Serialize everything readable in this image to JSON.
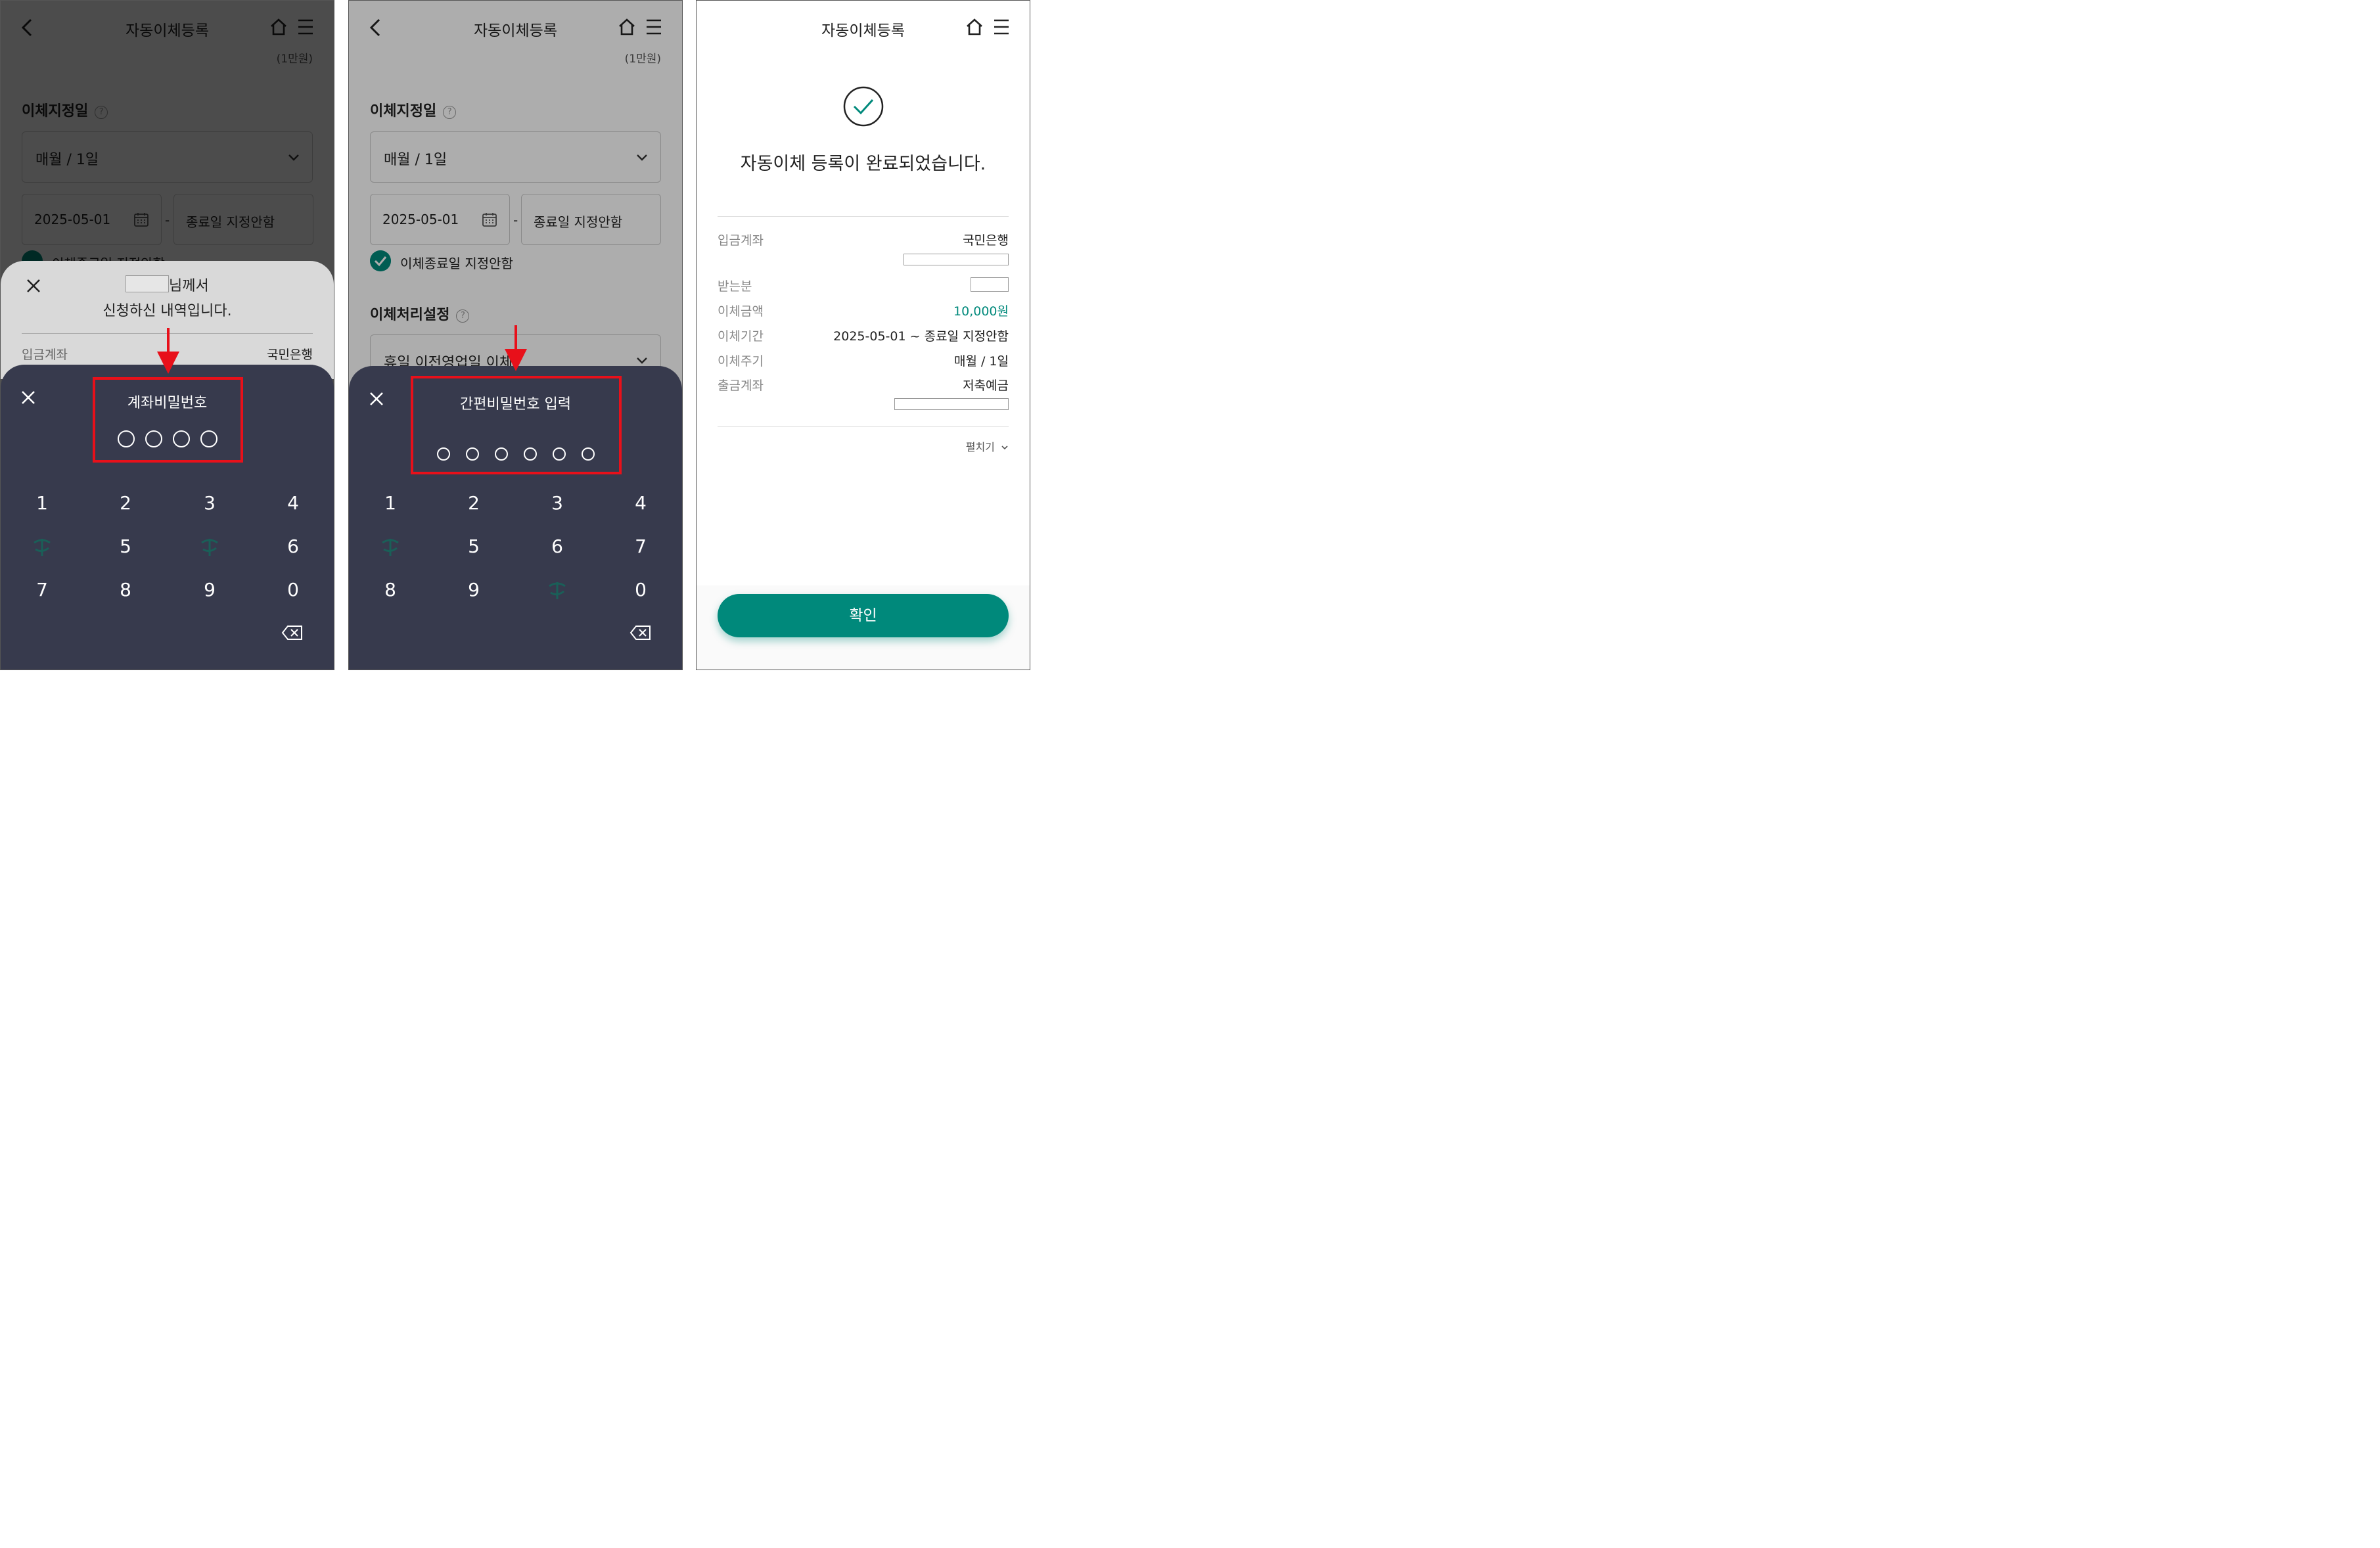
{
  "header": {
    "title": "자동이체등록"
  },
  "form": {
    "unit_note": "(1만원)",
    "date_section_label": "이체지정일",
    "period_select": "매월 / 1일",
    "start_date": "2025-05-01",
    "date_separator": "-",
    "end_date": "종료일 지정안함",
    "no_end_checkbox_label": "이체종료일 지정안함",
    "processing_section_label": "이체처리설정",
    "holiday_select": "휴일 이전영업일 이체"
  },
  "confirm_sheet": {
    "line1_suffix": "님께서",
    "line2": "신청하신 내역입니다.",
    "row_label": "입금계좌",
    "row_value": "국민은행"
  },
  "keypad_account": {
    "title": "계좌비밀번호",
    "keys": [
      "1",
      "2",
      "3",
      "4",
      "5",
      "6",
      "7",
      "8",
      "9",
      "0"
    ]
  },
  "keypad_simple": {
    "title": "간편비밀번호 입력",
    "keys": [
      "1",
      "2",
      "3",
      "4",
      "5",
      "6",
      "7",
      "8",
      "9",
      "0"
    ]
  },
  "result": {
    "message": "자동이체 등록이 완료되었습니다.",
    "rows": [
      {
        "label": "입금계좌",
        "value": "국민은행"
      },
      {
        "label": "받는분",
        "value": ""
      },
      {
        "label": "이체금액",
        "value": "10,000원"
      },
      {
        "label": "이체기간",
        "value": "2025-05-01 ~ 종료일 지정안함"
      },
      {
        "label": "이체주기",
        "value": "매월 / 1일"
      },
      {
        "label": "출금계좌",
        "value": "저축예금"
      }
    ],
    "expand_label": "펼치기",
    "confirm_button": "확인"
  },
  "colors": {
    "accent": "#00897b",
    "keypad_bg": "#373a4d",
    "highlight": "#e8101a",
    "amount": "#00897b"
  },
  "icons": [
    "back-icon",
    "home-icon",
    "menu-icon",
    "help-icon",
    "chevron-down-icon",
    "calendar-icon",
    "check-icon",
    "close-icon",
    "backspace-icon",
    "logo-icon",
    "arrow-down-icon"
  ]
}
